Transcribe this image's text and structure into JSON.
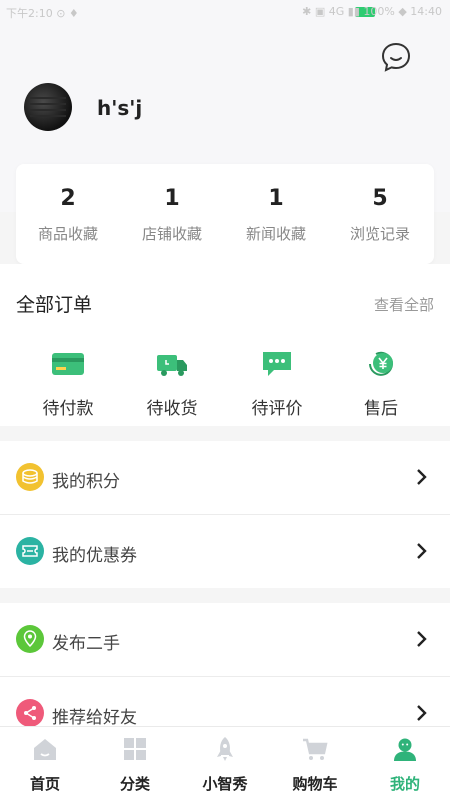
{
  "status_bar": {
    "left_text": "下午2:10 ⊙ ♦",
    "right_text": "✱ ▣ 4G ▮▮ 100% ◆ 14:40"
  },
  "profile": {
    "username": "h's'j"
  },
  "stats": [
    {
      "value": "2",
      "label": "商品收藏"
    },
    {
      "value": "1",
      "label": "店铺收藏"
    },
    {
      "value": "1",
      "label": "新闻收藏"
    },
    {
      "value": "5",
      "label": "浏览记录"
    }
  ],
  "orders": {
    "title": "全部订单",
    "view_all": "查看全部",
    "items": [
      {
        "label": "待付款",
        "icon": "card-icon"
      },
      {
        "label": "待收货",
        "icon": "truck-icon"
      },
      {
        "label": "待评价",
        "icon": "comment-icon"
      },
      {
        "label": "售后",
        "icon": "refund-icon"
      }
    ]
  },
  "menu": [
    {
      "label": "我的积分",
      "icon": "coins-icon",
      "color": "#f2c230"
    },
    {
      "label": "我的优惠券",
      "icon": "coupon-icon",
      "color": "#2bb3a3"
    },
    {
      "label": "发布二手",
      "icon": "location-icon",
      "color": "#5cc73a"
    },
    {
      "label": "推荐给好友",
      "icon": "share-icon",
      "color": "#ef5a7a"
    }
  ],
  "tabs": [
    {
      "label": "首页",
      "icon": "home-icon"
    },
    {
      "label": "分类",
      "icon": "grid-icon"
    },
    {
      "label": "小智秀",
      "icon": "rocket-icon"
    },
    {
      "label": "购物车",
      "icon": "cart-icon"
    },
    {
      "label": "我的",
      "icon": "user-icon",
      "active": true
    }
  ],
  "colors": {
    "accent": "#2fb37a",
    "tab_inactive_icon": "#d0d3d8",
    "header_bg": "#f7f7f9"
  }
}
